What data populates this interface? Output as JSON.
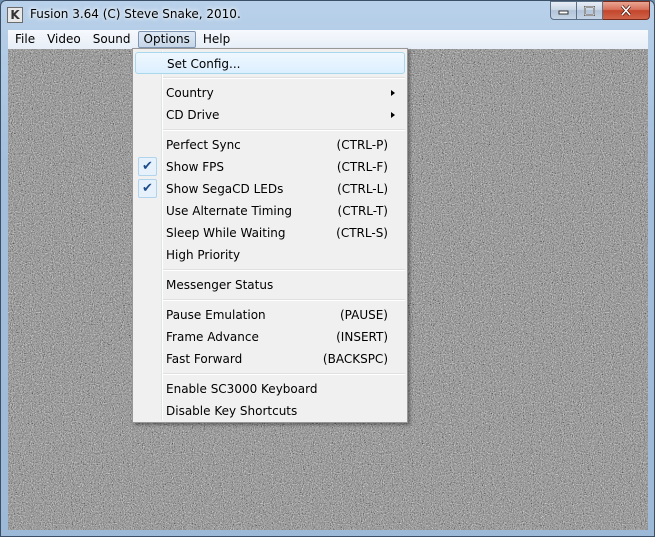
{
  "window": {
    "title": "Fusion 3.64 (C) Steve Snake, 2010.",
    "icon_letter": "K"
  },
  "menubar": {
    "items": [
      "File",
      "Video",
      "Sound",
      "Options",
      "Help"
    ],
    "active": "Options"
  },
  "options_menu": {
    "set_config": "Set Config...",
    "country": "Country",
    "cd_drive": "CD Drive",
    "perfect_sync": {
      "label": "Perfect Sync",
      "shortcut": "(CTRL-P)"
    },
    "show_fps": {
      "label": "Show FPS",
      "shortcut": "(CTRL-F)",
      "checked": true
    },
    "show_segacd_leds": {
      "label": "Show SegaCD LEDs",
      "shortcut": "(CTRL-L)",
      "checked": true
    },
    "alt_timing": {
      "label": "Use Alternate Timing",
      "shortcut": "(CTRL-T)"
    },
    "sleep_waiting": {
      "label": "Sleep While Waiting",
      "shortcut": "(CTRL-S)"
    },
    "high_priority": "High Priority",
    "messenger_status": "Messenger Status",
    "pause": {
      "label": "Pause Emulation",
      "shortcut": "(PAUSE)"
    },
    "frame_advance": {
      "label": "Frame Advance",
      "shortcut": "(INSERT)"
    },
    "fast_forward": {
      "label": "Fast Forward",
      "shortcut": "(BACKSPC)"
    },
    "sc3000_keyboard": "Enable SC3000 Keyboard",
    "disable_shortcuts": "Disable Key Shortcuts",
    "check_glyph": "✔"
  },
  "colors": {
    "highlight_border": "#a8d8eb",
    "close_button": "#c2452a",
    "menu_bg": "#f0f0f0"
  }
}
